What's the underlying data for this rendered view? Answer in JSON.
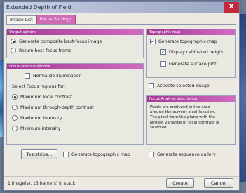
{
  "window": {
    "title": "Extended Depth of Field",
    "close_glyph": "X"
  },
  "tabs": [
    "Image List",
    "Focus Settings"
  ],
  "output_options": {
    "header": "Output options",
    "options": [
      "Generate composite best-focus image",
      "Return best-focus frame"
    ],
    "selected": 0
  },
  "focus_analysis": {
    "header": "Focus analysis options",
    "normalize_label": "Normalize illumination",
    "normalize_checked": false,
    "select_label": "Select Focus regions for:",
    "options": [
      "Maximum local contrast",
      "Maximum through-depth contrast",
      "Maximum intensity",
      "Minimum intensity"
    ],
    "selected": 0
  },
  "topographic_map": {
    "header": "Topographic map",
    "items": [
      {
        "label": "Generate topographic map",
        "checked": true
      },
      {
        "label": "Display calibrated height",
        "checked": true
      },
      {
        "label": "Generate surface plot",
        "checked": false
      }
    ]
  },
  "activate_selected": {
    "label": "Activate selected image",
    "checked": false
  },
  "description": {
    "header": "Focus Analysis description",
    "text": "Pixels are analyzed in the area\naround the current pixel location.\nThe pixel from the plane with the\nlargest variance or local contrast is\nselected."
  },
  "bottom_options": {
    "teststrips_label": "Teststrips...",
    "generate_topo_label": "Generate topographic map",
    "generate_topo_checked": false,
    "generate_gallery_label": "Generate sequence gallery",
    "generate_gallery_checked": false
  },
  "status": {
    "text": "1 image(s), 15 frame(s) in stack",
    "create_label": "Create",
    "cancel_label": "Cancel"
  }
}
